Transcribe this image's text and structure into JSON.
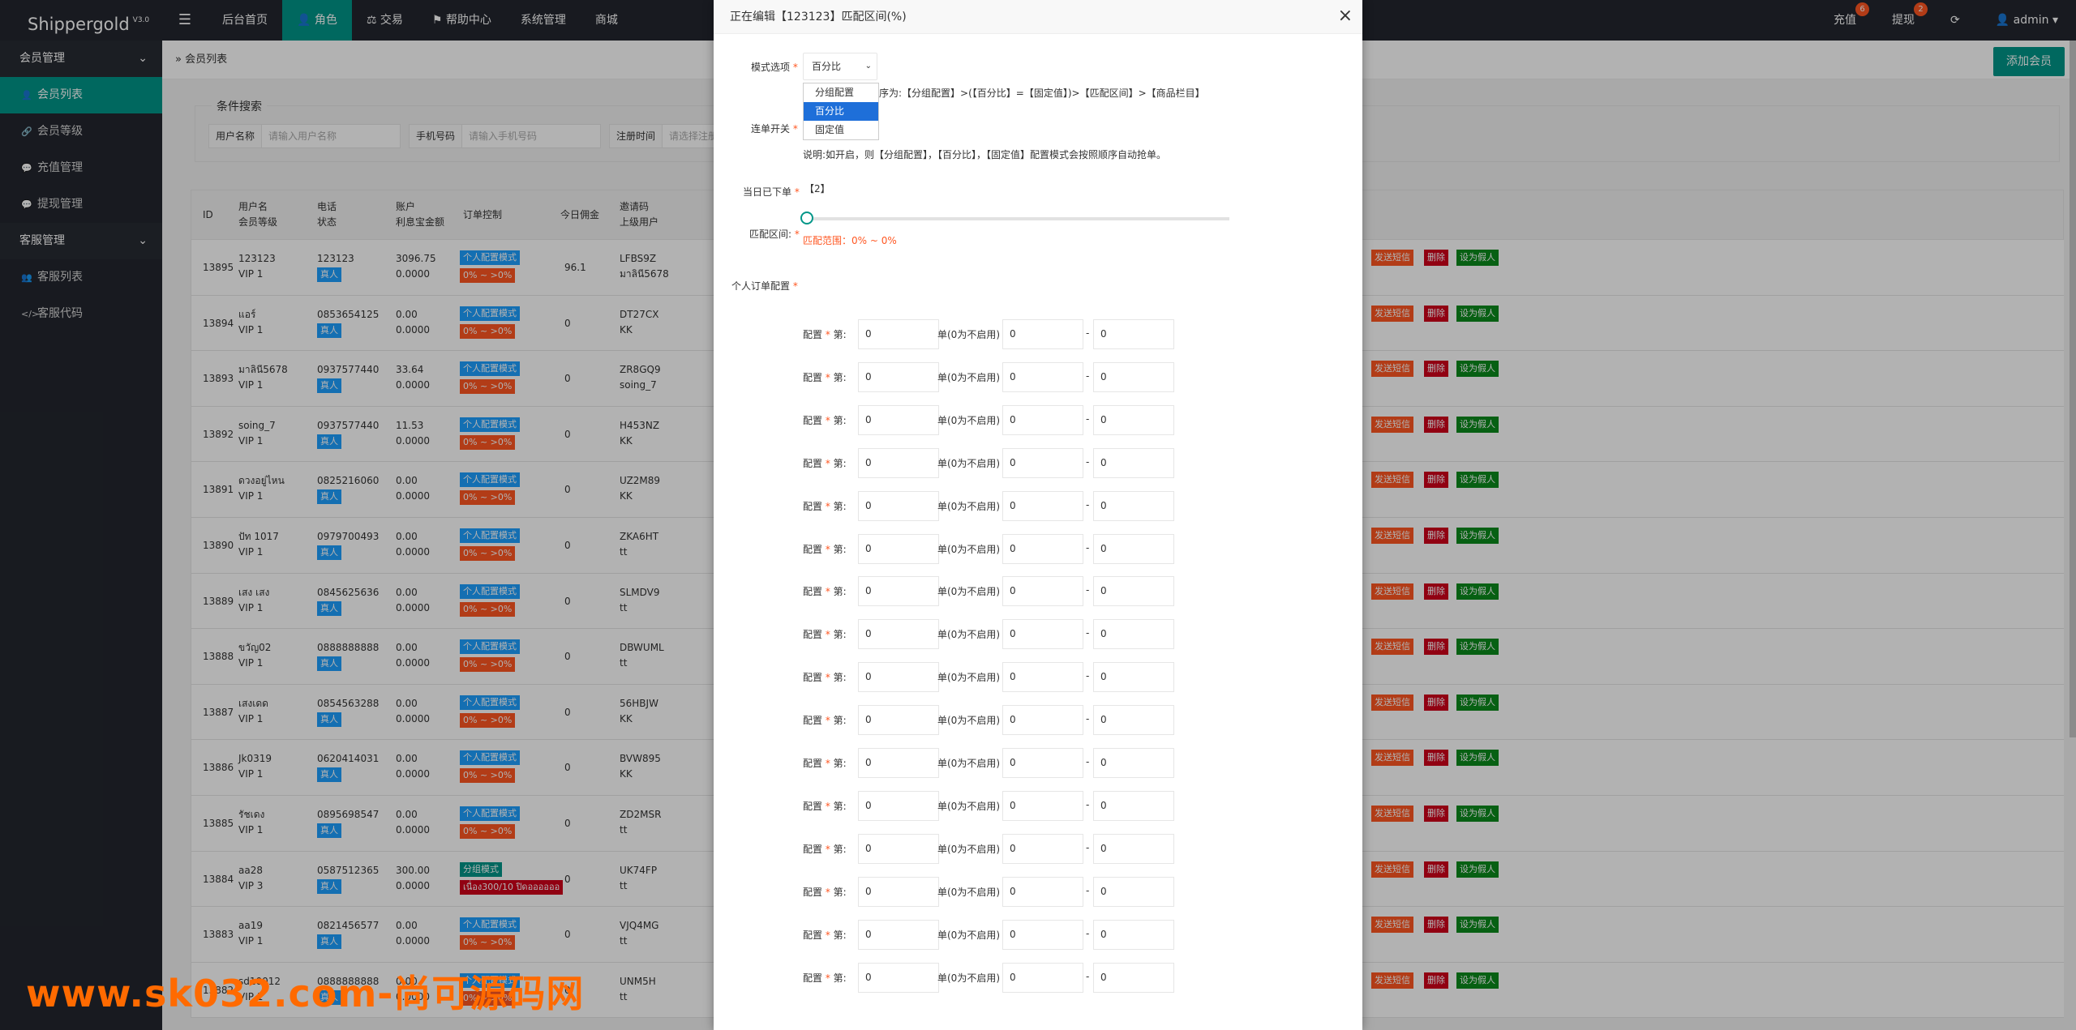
{
  "brand": {
    "name": "Shippergold",
    "version": "V3.0"
  },
  "topnav": [
    "后台首页",
    "角色",
    "交易",
    "帮助中心",
    "系统管理",
    "商城"
  ],
  "topnav_icons": {
    "role": "user-icon",
    "trade": "scale-icon",
    "help": "flag-icon"
  },
  "topright": {
    "recharge": "充值",
    "recharge_count": "6",
    "withdraw": "提现",
    "withdraw_count": "2",
    "user": "admin"
  },
  "sidebar": [
    {
      "type": "group",
      "label": "会员管理"
    },
    {
      "type": "item",
      "label": "会员列表",
      "icon": "user-icon",
      "active": true
    },
    {
      "type": "item",
      "label": "会员等级",
      "icon": "link-icon"
    },
    {
      "type": "item",
      "label": "充值管理",
      "icon": "chat-icon"
    },
    {
      "type": "item",
      "label": "提现管理",
      "icon": "chat-icon"
    },
    {
      "type": "group",
      "label": "客服管理"
    },
    {
      "type": "item",
      "label": "客服列表",
      "icon": "users-icon"
    },
    {
      "type": "item",
      "label": "客服代码",
      "icon": "code-icon"
    }
  ],
  "breadcrumb": "会员列表",
  "add_button": "添加会员",
  "search": {
    "legend": "条件搜索",
    "fields": [
      {
        "label": "用户名称",
        "placeholder": "请输入用户名称"
      },
      {
        "label": "手机号码",
        "placeholder": "请输入手机号码"
      },
      {
        "label": "注册时间",
        "placeholder": "请选择注册"
      }
    ]
  },
  "table": {
    "headers": [
      [
        "ID"
      ],
      [
        "用户名",
        "会员等级"
      ],
      [
        "电话",
        "状态"
      ],
      [
        "账户",
        "利息宝金额"
      ],
      [
        "订单控制"
      ],
      [
        "今日佣金"
      ],
      [
        "邀请码",
        "上级用户"
      ]
    ],
    "status_tag": "真人",
    "mode_tag": "个人配置模式",
    "range_tag": "0% ~ >0%",
    "actions": {
      "sms": "发送短信",
      "delete": "删除",
      "fake": "设为假人"
    },
    "rows": [
      {
        "id": "13895",
        "username": "123123",
        "vip": "VIP 1",
        "phone": "123123",
        "balance": "3096.75",
        "interest": "0.0000",
        "mode": "个人配置模式",
        "range": "0% ~ >0%",
        "commission": "96.1",
        "invite": "LFBS9Z",
        "parent": "มาลินี5678"
      },
      {
        "id": "13894",
        "username": "แอร์",
        "vip": "VIP 1",
        "phone": "0853654125",
        "balance": "0.00",
        "interest": "0.0000",
        "mode": "个人配置模式",
        "range": "0% ~ >0%",
        "commission": "0",
        "invite": "DT27CX",
        "parent": "KK"
      },
      {
        "id": "13893",
        "username": "มาลินี5678",
        "vip": "VIP 1",
        "phone": "0937577440",
        "balance": "33.64",
        "interest": "0.0000",
        "mode": "个人配置模式",
        "range": "0% ~ >0%",
        "commission": "0",
        "invite": "ZR8GQ9",
        "parent": "soing_7"
      },
      {
        "id": "13892",
        "username": "soing_7",
        "vip": "VIP 1",
        "phone": "0937577440",
        "balance": "11.53",
        "interest": "0.0000",
        "mode": "个人配置模式",
        "range": "0% ~ >0%",
        "commission": "0",
        "invite": "H453NZ",
        "parent": "KK"
      },
      {
        "id": "13891",
        "username": "ดวงอยู่ไหน",
        "vip": "VIP 1",
        "phone": "0825216060",
        "balance": "0.00",
        "interest": "0.0000",
        "mode": "个人配置模式",
        "range": "0% ~ >0%",
        "commission": "0",
        "invite": "UZ2M89",
        "parent": "KK"
      },
      {
        "id": "13890",
        "username": "ปัท 1017",
        "vip": "VIP 1",
        "phone": "0979700493",
        "balance": "0.00",
        "interest": "0.0000",
        "mode": "个人配置模式",
        "range": "0% ~ >0%",
        "commission": "0",
        "invite": "ZKA6HT",
        "parent": "tt"
      },
      {
        "id": "13889",
        "username": "เสง เสง",
        "vip": "VIP 1",
        "phone": "0845625636",
        "balance": "0.00",
        "interest": "0.0000",
        "mode": "个人配置模式",
        "range": "0% ~ >0%",
        "commission": "0",
        "invite": "SLMDV9",
        "parent": "tt"
      },
      {
        "id": "13888",
        "username": "ขวัญ02",
        "vip": "VIP 1",
        "phone": "0888888888",
        "balance": "0.00",
        "interest": "0.0000",
        "mode": "个人配置模式",
        "range": "0% ~ >0%",
        "commission": "0",
        "invite": "DBWUML",
        "parent": "tt"
      },
      {
        "id": "13887",
        "username": "เสงเดด",
        "vip": "VIP 1",
        "phone": "0854563288",
        "balance": "0.00",
        "interest": "0.0000",
        "mode": "个人配置模式",
        "range": "0% ~ >0%",
        "commission": "0",
        "invite": "56HBJW",
        "parent": "KK"
      },
      {
        "id": "13886",
        "username": "Jk0319",
        "vip": "VIP 1",
        "phone": "0620414031",
        "balance": "0.00",
        "interest": "0.0000",
        "mode": "个人配置模式",
        "range": "0% ~ >0%",
        "commission": "0",
        "invite": "BVW895",
        "parent": "KK"
      },
      {
        "id": "13885",
        "username": "รัชเดง",
        "vip": "VIP 1",
        "phone": "0895698547",
        "balance": "0.00",
        "interest": "0.0000",
        "mode": "个人配置模式",
        "range": "0% ~ >0%",
        "commission": "0",
        "invite": "ZD2MSR",
        "parent": "tt"
      },
      {
        "id": "13884",
        "username": "aa28",
        "vip": "VIP 3",
        "phone": "0587512365",
        "balance": "300.00",
        "interest": "0.0000",
        "mode": "分组模式",
        "range": "เนื่อง300/10 ปิดออออออ",
        "commission": "0",
        "invite": "UK74FP",
        "parent": "tt"
      },
      {
        "id": "13883",
        "username": "aa19",
        "vip": "VIP 1",
        "phone": "0821456577",
        "balance": "0.00",
        "interest": "0.0000",
        "mode": "个人配置模式",
        "range": "0% ~ >0%",
        "commission": "0",
        "invite": "VJQ4MG",
        "parent": "tt"
      },
      {
        "id": "13882",
        "username": "sd10012",
        "vip": "VIP 1",
        "phone": "0888888888",
        "balance": "0.00",
        "interest": "0.0000",
        "mode": "个人配置模式",
        "range": "0% ~ >0%",
        "commission": "0",
        "invite": "UNM5H",
        "parent": "tt"
      }
    ]
  },
  "modal": {
    "title": "正在编辑【123123】匹配区间(%)",
    "mode_label": "模式选项",
    "mode_value": "百分比",
    "mode_options": [
      "分组配置",
      "百分比",
      "固定值"
    ],
    "mode_note": "序为:【分组配置】>(【百分比】=【固定值】)>【匹配区间】>【商品栏目】",
    "chain_label": "连单开关",
    "chain_note": "说明:如开启，则【分组配置】，【百分比】，【固定值】配置模式会按照顺序自动抢单。",
    "today_label": "当日已下单",
    "today_value": "【2】",
    "range_label": "匹配区间:",
    "range_note": "匹配范围：0% ~ 0%",
    "slider_value": 0,
    "personal_label": "个人订单配置",
    "config_label": "配置",
    "config_suffix": "第:",
    "config_mid": "单(0为不启用)",
    "config_dash": "-",
    "config_rows": [
      [
        "0",
        "0",
        "0"
      ],
      [
        "0",
        "0",
        "0"
      ],
      [
        "0",
        "0",
        "0"
      ],
      [
        "0",
        "0",
        "0"
      ],
      [
        "0",
        "0",
        "0"
      ],
      [
        "0",
        "0",
        "0"
      ],
      [
        "0",
        "0",
        "0"
      ],
      [
        "0",
        "0",
        "0"
      ],
      [
        "0",
        "0",
        "0"
      ],
      [
        "0",
        "0",
        "0"
      ],
      [
        "0",
        "0",
        "0"
      ],
      [
        "0",
        "0",
        "0"
      ],
      [
        "0",
        "0",
        "0"
      ],
      [
        "0",
        "0",
        "0"
      ],
      [
        "0",
        "0",
        "0"
      ],
      [
        "0",
        "0",
        "0"
      ]
    ]
  },
  "watermark": "www.sk032.com-尚可源码网"
}
